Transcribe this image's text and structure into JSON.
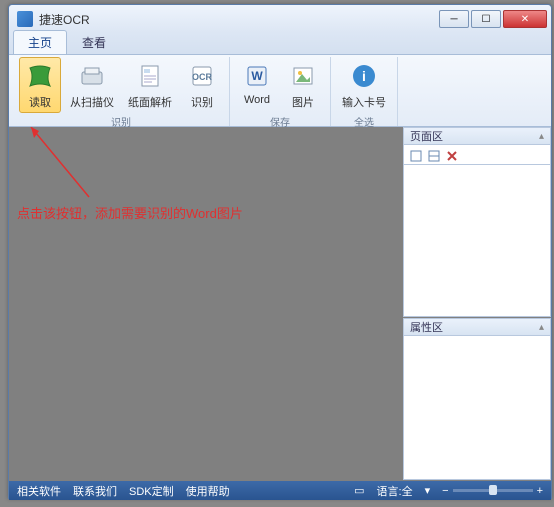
{
  "window": {
    "title": "捷速OCR"
  },
  "tabs": {
    "items": [
      {
        "label": "主页",
        "active": true
      },
      {
        "label": "查看",
        "active": false
      }
    ]
  },
  "ribbon": {
    "read_btn": "读取",
    "scanner_btn": "从扫描仪",
    "parse_btn": "纸面解析",
    "recognize_btn": "识别",
    "word_btn": "Word",
    "image_btn": "图片",
    "card_btn": "输入卡号",
    "group_recognize": "识别",
    "group_save": "保存",
    "group_all": "全选"
  },
  "annotation": {
    "text": "点击该按钮，添加需要识别的Word图片"
  },
  "panes": {
    "page_area": "页面区",
    "property_area": "属性区"
  },
  "status": {
    "about": "相关软件",
    "contact": "联系我们",
    "sdk": "SDK定制",
    "help": "使用帮助",
    "lang": "语言:全",
    "zoom_minus": "−",
    "zoom_plus": "+"
  }
}
